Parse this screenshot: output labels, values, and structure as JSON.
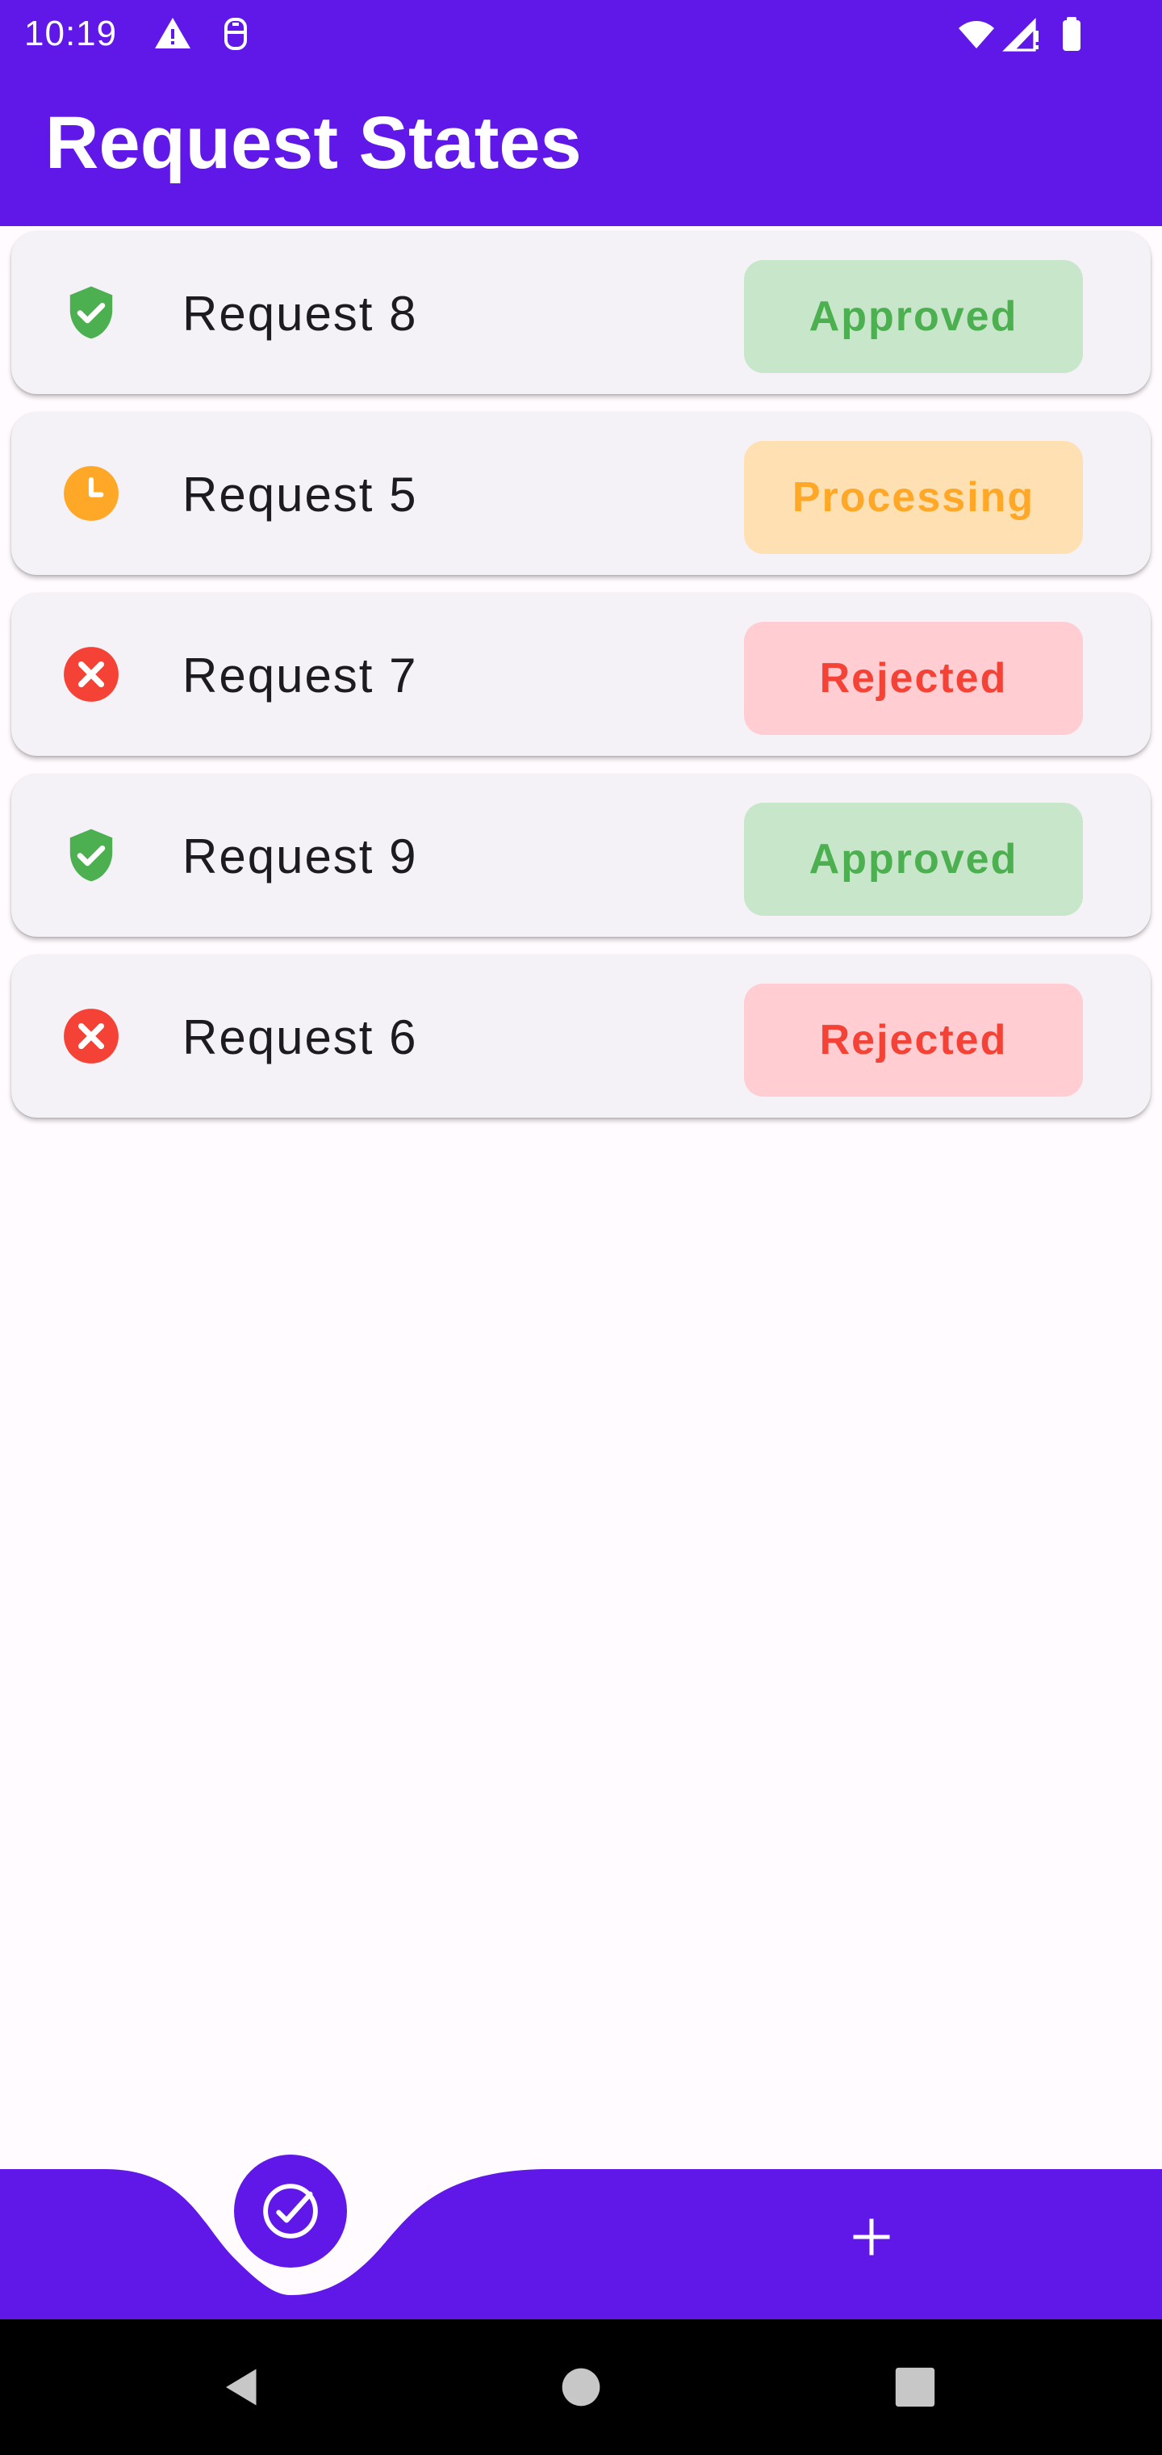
{
  "status_bar": {
    "time": "10:19",
    "icons": [
      "warning-icon",
      "sim-card-icon",
      "wifi-icon",
      "cellular-signal-icon",
      "battery-icon"
    ]
  },
  "app_bar": {
    "title": "Request States",
    "color": "#6018e8"
  },
  "requests": [
    {
      "label": "Request 8",
      "status": "Approved",
      "icon": "shield-check-icon"
    },
    {
      "label": "Request 5",
      "status": "Processing",
      "icon": "clock-icon"
    },
    {
      "label": "Request 7",
      "status": "Rejected",
      "icon": "cancel-circle-icon"
    },
    {
      "label": "Request 9",
      "status": "Approved",
      "icon": "shield-check-icon"
    },
    {
      "label": "Request 6",
      "status": "Rejected",
      "icon": "cancel-circle-icon"
    }
  ],
  "status_colors": {
    "Approved": {
      "text": "#4caf50",
      "bg": "#c8e6c9"
    },
    "Processing": {
      "text": "#ffa726",
      "bg": "#ffe0b2"
    },
    "Rejected": {
      "text": "#f44336",
      "bg": "#ffcdd2"
    }
  },
  "bottom_nav": {
    "items": [
      {
        "icon": "check-circle-icon",
        "selected": true
      },
      {
        "icon": "plus-icon",
        "selected": false
      }
    ]
  },
  "system_nav": {
    "items": [
      "back-icon",
      "home-icon",
      "recents-icon"
    ]
  }
}
